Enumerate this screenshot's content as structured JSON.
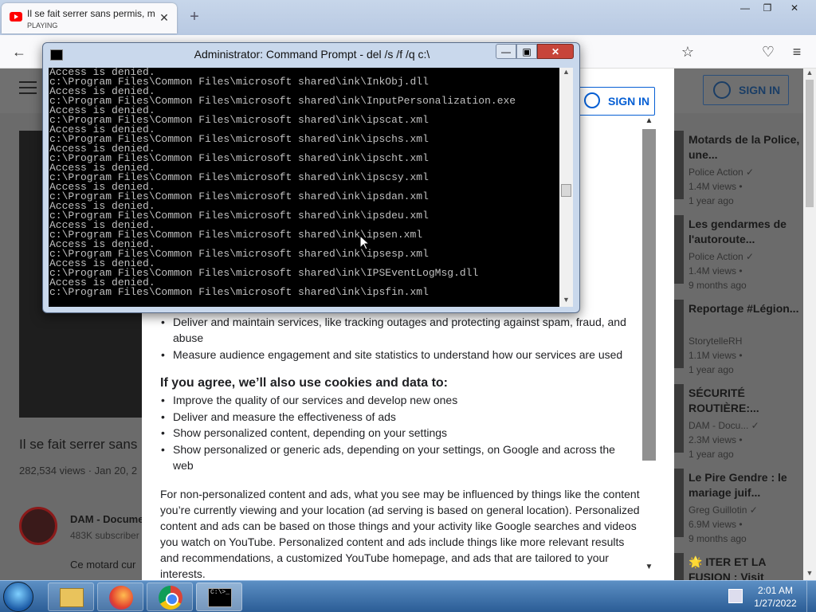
{
  "browser": {
    "tab": {
      "title": "Il se fait serrer sans permis, mai",
      "subtitle": "PLAYING",
      "close": "✕"
    },
    "new_tab": "+",
    "window_controls": {
      "minimize": "—",
      "maximize": "❐",
      "close": "✕"
    },
    "toolbar": {
      "back": "←",
      "bookmark": "☆",
      "pocket": "♡",
      "menu": "≡"
    }
  },
  "youtube": {
    "sign_in": "SIGN IN",
    "video_title": "Il se fait serrer sans",
    "video_meta": "282,534 views · Jan 20, 2",
    "channel_name": "DAM - Docume",
    "channel_subs": "483K subscriber",
    "description": "Ce motard cur",
    "sidebar": [
      {
        "title": "Motards de la Police, une...",
        "channel": "Police Action ✓",
        "views": "1.4M views •",
        "ago": "1 year ago"
      },
      {
        "title": "Les gendarmes de l'autoroute...",
        "channel": "Police Action ✓",
        "views": "1.4M views •",
        "ago": "9 months ago"
      },
      {
        "title": "Reportage #Légion...",
        "channel": "StorytelleRH",
        "views": "1.1M views •",
        "ago": "1 year ago"
      },
      {
        "title": "SÉCURITÉ ROUTIÈRE:...",
        "channel": "DAM - Docu... ✓",
        "views": "2.3M views •",
        "ago": "1 year ago"
      },
      {
        "title": "Le Pire Gendre : le mariage juif...",
        "channel": "Greg Guillotin ✓",
        "views": "6.9M views •",
        "ago": "9 months ago"
      },
      {
        "title": "🌟 ITER ET LA FUSION : Visit",
        "channel": "",
        "views": "",
        "ago": ""
      }
    ]
  },
  "consent": {
    "sign_in": "SIGN IN",
    "bullets_top": [
      "Deliver and maintain services, like tracking outages and protecting against spam, fraud, and abuse",
      "Measure audience engagement and site statistics to understand how our services are used"
    ],
    "heading": "If you agree, we’ll also use cookies and data to:",
    "bullets_agree": [
      "Improve the quality of our services and develop new ones",
      "Deliver and measure the effectiveness of ads",
      "Show personalized content, depending on your settings",
      "Show personalized or generic ads, depending on your settings, on Google and across the web"
    ],
    "paragraph": "For non-personalized content and ads, what you see may be influenced by things like the content you’re currently viewing and your location (ad serving is based on general location). Personalized content and ads can be based on those things and your activity like Google searches and videos you watch on YouTube. Personalized content and ads include things like more relevant results and recommendations, a customized YouTube homepage, and ads that are tailored to your interests."
  },
  "cmd": {
    "title": "Administrator: Command Prompt - del  /s /f /q c:\\",
    "lines": [
      "Access is denied.",
      "c:\\Program Files\\Common Files\\microsoft shared\\ink\\InkObj.dll",
      "Access is denied.",
      "c:\\Program Files\\Common Files\\microsoft shared\\ink\\InputPersonalization.exe",
      "Access is denied.",
      "c:\\Program Files\\Common Files\\microsoft shared\\ink\\ipscat.xml",
      "Access is denied.",
      "c:\\Program Files\\Common Files\\microsoft shared\\ink\\ipschs.xml",
      "Access is denied.",
      "c:\\Program Files\\Common Files\\microsoft shared\\ink\\ipscht.xml",
      "Access is denied.",
      "c:\\Program Files\\Common Files\\microsoft shared\\ink\\ipscsy.xml",
      "Access is denied.",
      "c:\\Program Files\\Common Files\\microsoft shared\\ink\\ipsdan.xml",
      "Access is denied.",
      "c:\\Program Files\\Common Files\\microsoft shared\\ink\\ipsdeu.xml",
      "Access is denied.",
      "c:\\Program Files\\Common Files\\microsoft shared\\ink\\ipsen.xml",
      "Access is denied.",
      "c:\\Program Files\\Common Files\\microsoft shared\\ink\\ipsesp.xml",
      "Access is denied.",
      "c:\\Program Files\\Common Files\\microsoft shared\\ink\\IPSEventLogMsg.dll",
      "Access is denied.",
      "c:\\Program Files\\Common Files\\microsoft shared\\ink\\ipsfin.xml"
    ],
    "buttons": {
      "minimize": "—",
      "maximize": "▣",
      "close": "✕"
    }
  },
  "taskbar": {
    "cmd_icon_text": "C:\\>_",
    "time": "2:01 AM",
    "date": "1/27/2022"
  }
}
